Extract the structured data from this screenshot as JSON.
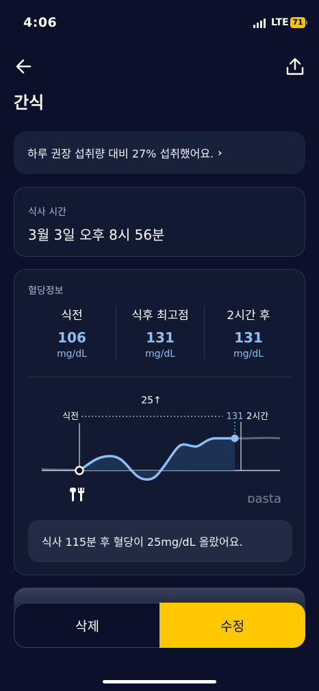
{
  "status_bar": {
    "time": "4:06",
    "network": "LTE",
    "battery": "71"
  },
  "header": {
    "title": "간식",
    "back_icon": "arrow-left-icon",
    "share_icon": "share-icon"
  },
  "intake_banner": {
    "text": "하루 권장 섭취량 대비 27% 섭취했어요.",
    "chevron": "›"
  },
  "meal_time": {
    "label": "식사 시간",
    "value": "3월 3일 오후 8시 56분"
  },
  "glucose": {
    "label": "혈당정보",
    "stats": [
      {
        "title": "식전",
        "value": "106",
        "unit": "mg/dL"
      },
      {
        "title": "식후 최고점",
        "value": "131",
        "unit": "mg/dL"
      },
      {
        "title": "2시간 후",
        "value": "131",
        "unit": "mg/dL"
      }
    ],
    "chart": {
      "rise_label": "25↑",
      "start_label": "식전",
      "peak_label": "131",
      "end_label": "2시간",
      "watermark": "pasta",
      "line_color": "#8fbef5",
      "fill_color": "#1e3556"
    },
    "summary": "식사 115분 후 혈당이 25mg/dL 올랐어요."
  },
  "actions": {
    "delete_label": "삭제",
    "edit_label": "수정",
    "edit_color": "#ffc800"
  }
}
